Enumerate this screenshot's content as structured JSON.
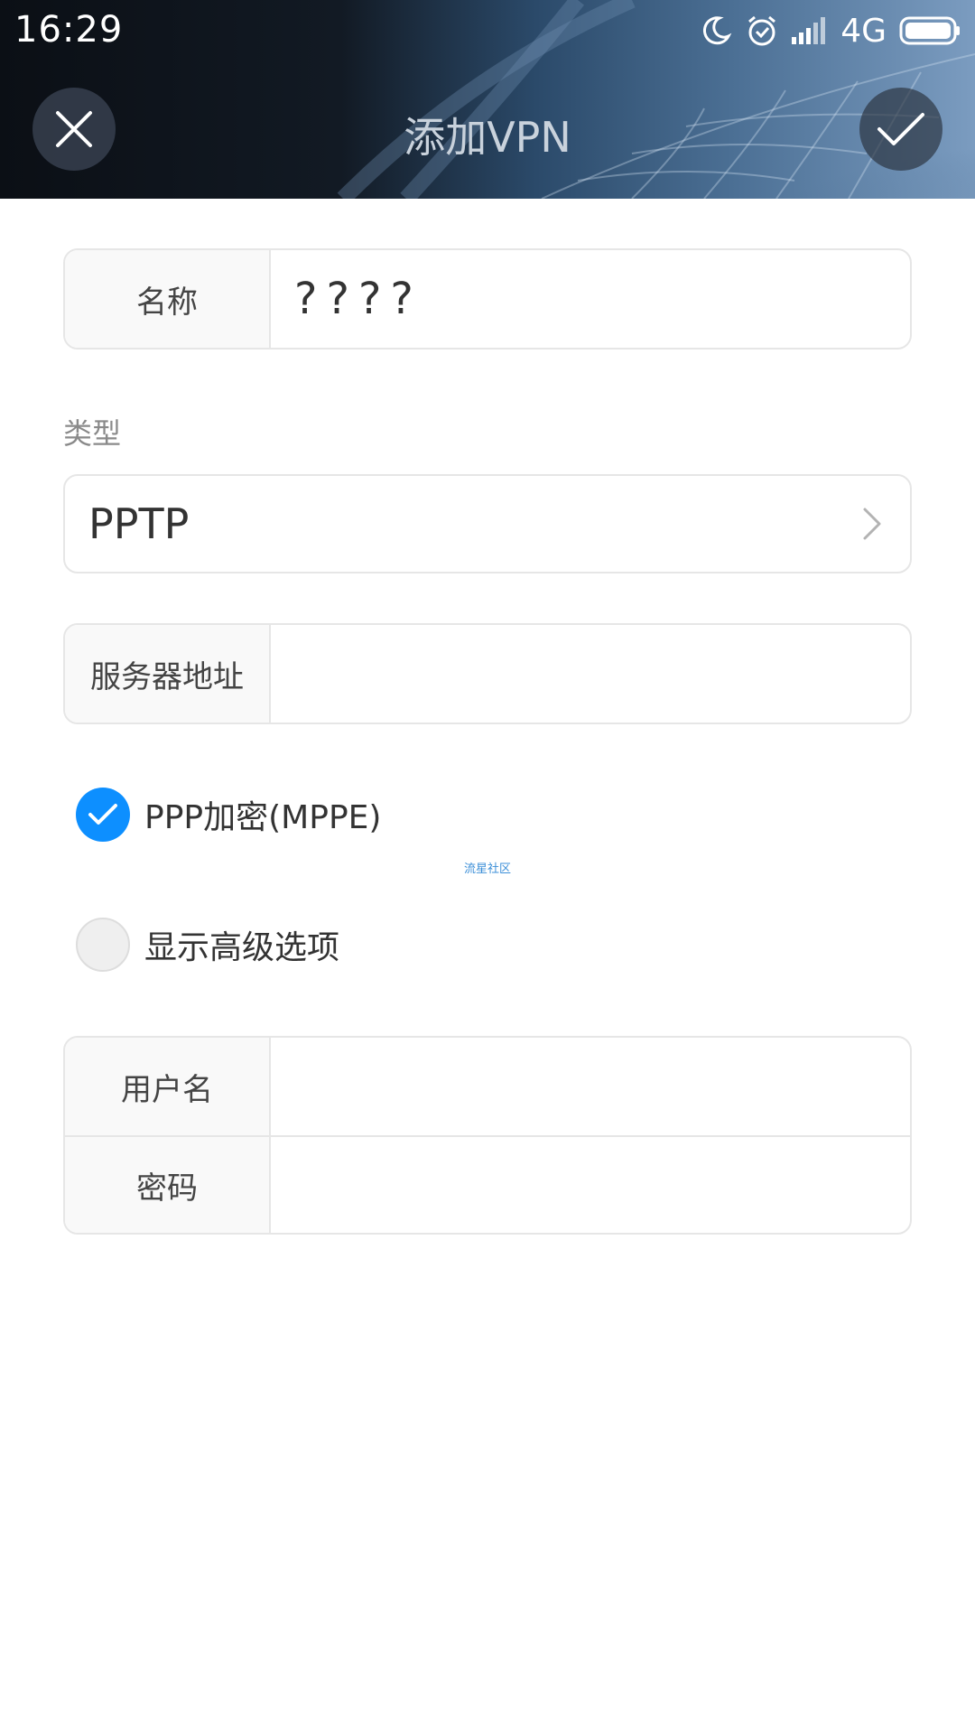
{
  "status_bar": {
    "time": "16:29",
    "network": "4G",
    "icons": [
      "moon-icon",
      "alarm-icon",
      "signal-icon",
      "battery-icon"
    ]
  },
  "header": {
    "title": "添加VPN",
    "close_icon": "close-icon",
    "confirm_icon": "check-icon"
  },
  "form": {
    "name": {
      "label": "名称",
      "value": "????"
    },
    "type_section_label": "类型",
    "type": {
      "value": "PPTP",
      "icon": "chevron-right-icon"
    },
    "server": {
      "label": "服务器地址",
      "value": ""
    },
    "ppp_encryption": {
      "label": "PPP加密(MPPE)",
      "checked": true
    },
    "advanced": {
      "label": "显示高级选项",
      "checked": false
    },
    "username": {
      "label": "用户名",
      "value": ""
    },
    "password": {
      "label": "密码",
      "value": ""
    }
  },
  "watermark": "流星社区",
  "colors": {
    "accent": "#0d8fff",
    "border": "#e6e6e6",
    "label_bg": "#f9f9f9"
  }
}
